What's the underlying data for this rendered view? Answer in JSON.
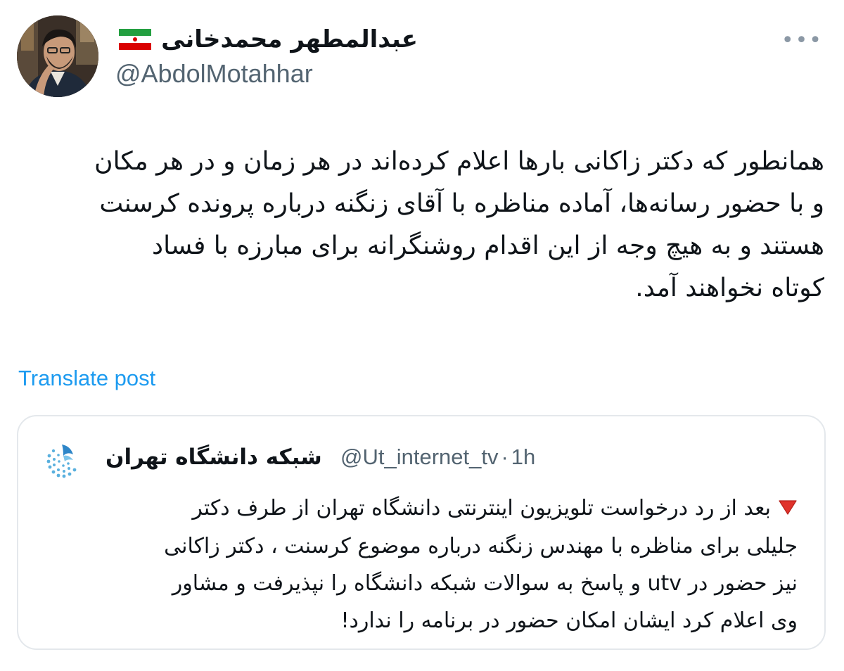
{
  "author": {
    "name": "عبدالمطهر محمدخانی",
    "handle": "@AbdolMotahhar",
    "flag_icon": "iran-flag-icon",
    "more_icon": "more-options-icon",
    "more_glyph": "•••"
  },
  "post": {
    "lines": [
      "همانطور که دکتر زاکانی بارها اعلام کرده‌اند در هر زمان و در هر مکان",
      "و با حضور رسانه‌ها، آماده مناظره با آقای زنگنه درباره پرونده کرسنت",
      "هستند و به هیچ وجه از این اقدام روشنگرانه برای مبارزه با فساد",
      "کوتاه نخواهند آمد."
    ]
  },
  "translate_label": "Translate post",
  "quote": {
    "name": "شبکه دانشگاه تهران",
    "handle": "@Ut_internet_tv",
    "separator": "·",
    "time": "1h",
    "lines": [
      "بعد از رد درخواست تلویزیون اینترنتی دانشگاه تهران از طرف دکتر",
      "جلیلی برای مناظره با مهندس زنگنه درباره موضوع کرسنت ، دکتر زاکانی",
      "نیز حضور در utv و پاسخ به سوالات شبکه دانشگاه را نپذیرفت و مشاور",
      "وی اعلام کرد ایشان امکان حضور در برنامه را ندارد!"
    ],
    "marker_icon": "red-down-triangle-icon"
  },
  "colors": {
    "link": "#1d9bf0",
    "secondary_text": "#536471",
    "border": "#e4e8ec",
    "marker": "#e0322b"
  }
}
